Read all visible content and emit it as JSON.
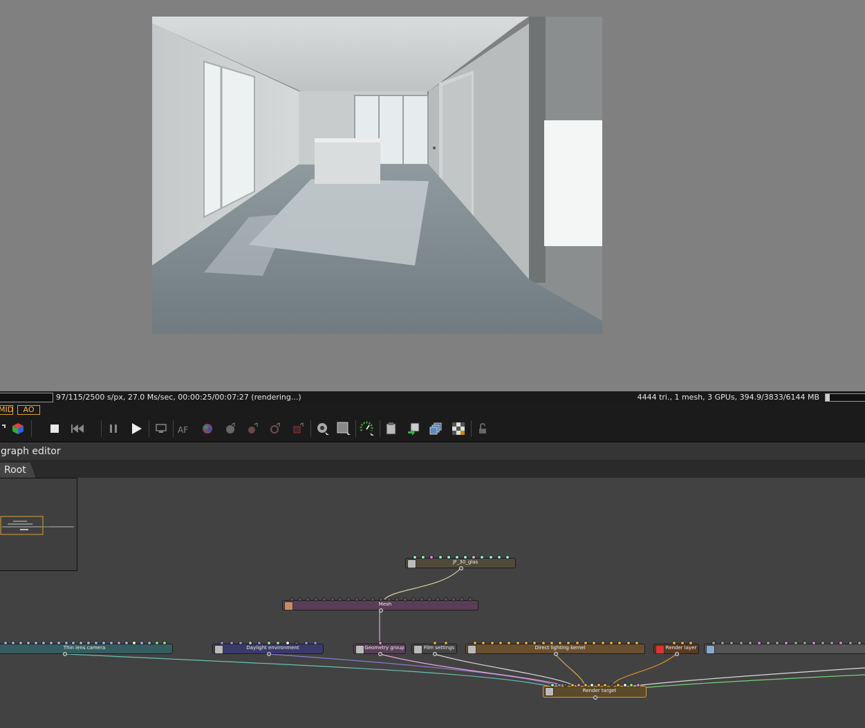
{
  "status": {
    "left": "97/115/2500 s/px, 27.0 Ms/sec, 00:00:25/00:07:27 (rendering...)",
    "right": "4444 tri., 1 mesh, 3 GPUs, 394.9/3833/6144 MB",
    "gpu_memory_fill": 0.1
  },
  "passes": {
    "mid": "MID",
    "ao": "AO"
  },
  "toolbar": {
    "items": [
      "scene-icon",
      "cube-icon",
      "stop-icon",
      "restart-icon",
      "pause-icon",
      "play-icon",
      "display-icon",
      "af-icon",
      "color-picker-icon",
      "material-picker-icon",
      "focus-picker-icon",
      "white-balance-icon",
      "region-icon",
      "camera-settings-icon",
      "denoise-icon",
      "gauge-icon",
      "clipboard-icon",
      "export-icon",
      "layers-icon",
      "checker-icon",
      "lock-icon"
    ],
    "af_label": "AF"
  },
  "graph_editor": {
    "title": "graph editor",
    "tabs": [
      {
        "label": "Root"
      }
    ],
    "nodes": [
      {
        "id": "geo",
        "label": "JF_30_glas"
      },
      {
        "id": "mesh",
        "label": "Mesh"
      },
      {
        "id": "camera",
        "label": "Thin lens camera"
      },
      {
        "id": "daylight",
        "label": "Daylight environment"
      },
      {
        "id": "geogroup",
        "label": "Geometry group"
      },
      {
        "id": "film",
        "label": "Film settings"
      },
      {
        "id": "kernel",
        "label": "Direct lighting kernel"
      },
      {
        "id": "renderlayer",
        "label": "Render layer"
      },
      {
        "id": "imager",
        "label": ""
      },
      {
        "id": "rendertarget",
        "label": "Render target"
      }
    ]
  },
  "colors": {
    "accent_orange": "#ffb040",
    "camera_node": "#355d5f",
    "daylight_node": "#3a3a6a",
    "mesh_node": "#5a3d57",
    "kernel_node": "#6a4f2f",
    "rendertarget_node": "#5b4a2b",
    "renderlayer_node": "#5a3a22",
    "geo_node": "#514a3a"
  }
}
